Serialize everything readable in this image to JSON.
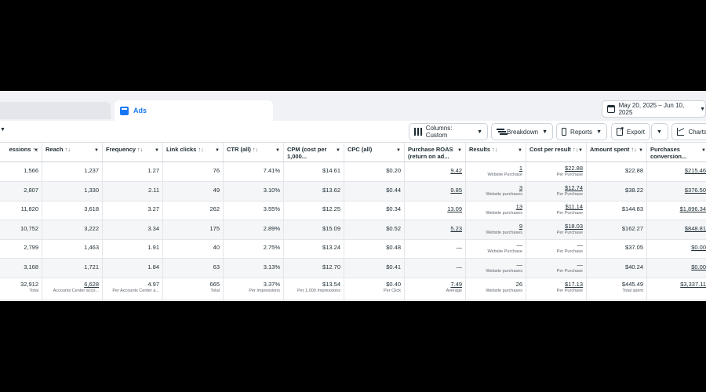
{
  "tabs": {
    "active_label": "Ads"
  },
  "date_range": "May 20, 2025 – Jun 10, 2025",
  "toolbar": {
    "columns_label": "Columns: Custom",
    "breakdown_label": "Breakdown",
    "reports_label": "Reports",
    "export_label": "Export",
    "charts_label": "Charts"
  },
  "headers": [
    "essions",
    "Reach",
    "Frequency",
    "Link clicks",
    "CTR (all)",
    "CPM (cost per 1,000...",
    "CPC (all)",
    "Purchase ROAS (return on ad...",
    "Results",
    "Cost per result",
    "Amount spent",
    "Purchases conversion..."
  ],
  "rows": [
    [
      "1,566",
      "1,237",
      "1.27",
      "76",
      "7.41%",
      "$14.61",
      "$0.20",
      "9.42",
      "1",
      "$22.88",
      "$22.88",
      "$215.46"
    ],
    [
      "2,807",
      "1,330",
      "2.11",
      "49",
      "3.10%",
      "$13.62",
      "$0.44",
      "9.85",
      "3",
      "$12.74",
      "$38.22",
      "$376.50"
    ],
    [
      "11,820",
      "3,618",
      "3.27",
      "262",
      "3.55%",
      "$12.25",
      "$0.34",
      "13.09",
      "13",
      "$11.14",
      "$144.83",
      "$1,896.34"
    ],
    [
      "10,752",
      "3,222",
      "3.34",
      "175",
      "2.89%",
      "$15.09",
      "$0.52",
      "5.23",
      "9",
      "$18.03",
      "$162.27",
      "$848.81"
    ],
    [
      "2,799",
      "1,463",
      "1.91",
      "40",
      "2.75%",
      "$13.24",
      "$0.48",
      "—",
      "—",
      "—",
      "$37.05",
      "$0.00"
    ],
    [
      "3,168",
      "1,721",
      "1.84",
      "63",
      "3.13%",
      "$12.70",
      "$0.41",
      "—",
      "—",
      "—",
      "$40.24",
      "$0.00"
    ]
  ],
  "result_subs": [
    "Website Purchase",
    "Website purchases",
    "Website purchases",
    "Website purchases",
    "Website Purchase",
    "Website purchases"
  ],
  "cost_sub": "Per Purchase",
  "totals": [
    "32,912",
    "6,628",
    "4.97",
    "665",
    "3.37%",
    "$13.54",
    "$0.40",
    "7.49",
    "26",
    "$17.13",
    "$445.49",
    "$3,337.11"
  ],
  "totals_subs": [
    "Total",
    "Accounts Center acco...",
    "Per Accounts Center a...",
    "Total",
    "Per Impressions",
    "Per 1,000 Impressions",
    "Per Click",
    "Average",
    "Website purchases",
    "Per Purchase",
    "Total spent",
    ""
  ]
}
